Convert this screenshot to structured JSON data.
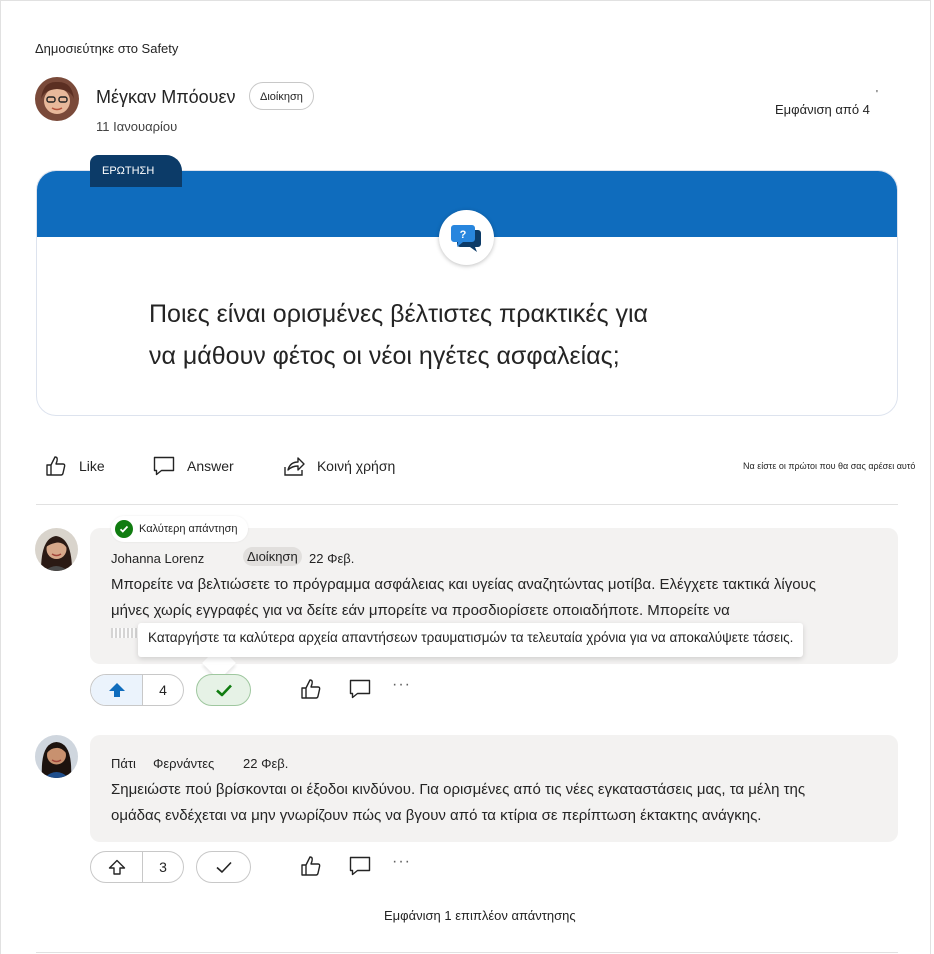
{
  "post": {
    "posted_in": "Δημοσιεύτηκε στο Safety",
    "author_name": "Μέγκαν Μπόουεν",
    "author_badge": "Διοίκηση",
    "date": "11 Ιανουαρίου",
    "viewed_by": "Εμφάνιση από 4",
    "viewed_dot": "'"
  },
  "question": {
    "tag": "ΕΡΩΤΗΣΗ",
    "line1": "Ποιες είναι ορισμένες βέλτιστες πρακτικές για",
    "line2": "να μάθουν φέτος οι νέοι ηγέτες ασφαλείας;",
    "accent": "#0f6cbd"
  },
  "actions": {
    "like": "Like",
    "answer": "Answer",
    "share": "Κοινή χρήση",
    "first_like": "Να είστε οι πρώτοι που θα σας αρέσει αυτό"
  },
  "answers": [
    {
      "best_label": "Καλύτερη απάντηση",
      "author": "Johanna Lorenz",
      "badge": "Διοίκηση",
      "date": "22 Φεβ.",
      "line1": "Μπορείτε να βελτιώσετε το πρόγραμμα ασφάλειας και υγείας αναζητώντας μοτίβα. Ελέγχετε τακτικά λίγους",
      "line2": "μήνες χωρίς εγγραφές για να δείτε εάν μπορείτε να προσδιορίσετε οποιαδήποτε. Μπορείτε να",
      "tooltip": "Καταργήστε τα καλύτερα αρχεία απαντήσεων τραυματισμών τα τελευταία χρόνια για να αποκαλύψετε τάσεις.",
      "votes": "4",
      "more": "···"
    },
    {
      "author_first": "Πάτι",
      "author_last": "Φερνάντες",
      "date": "22 Φεβ.",
      "line1": "Σημειώστε πού βρίσκονται οι έξοδοι κινδύνου. Για ορισμένες από τις νέες εγκαταστάσεις μας, τα μέλη της",
      "line2": "ομάδας ενδέχεται να μην γνωρίζουν πώς να βγουν από τα κτίρια σε περίπτωση έκτακτης ανάγκης.",
      "votes": "3",
      "more": "···"
    }
  ],
  "show_more": "Εμφάνιση 1 επιπλέον απάντησης"
}
